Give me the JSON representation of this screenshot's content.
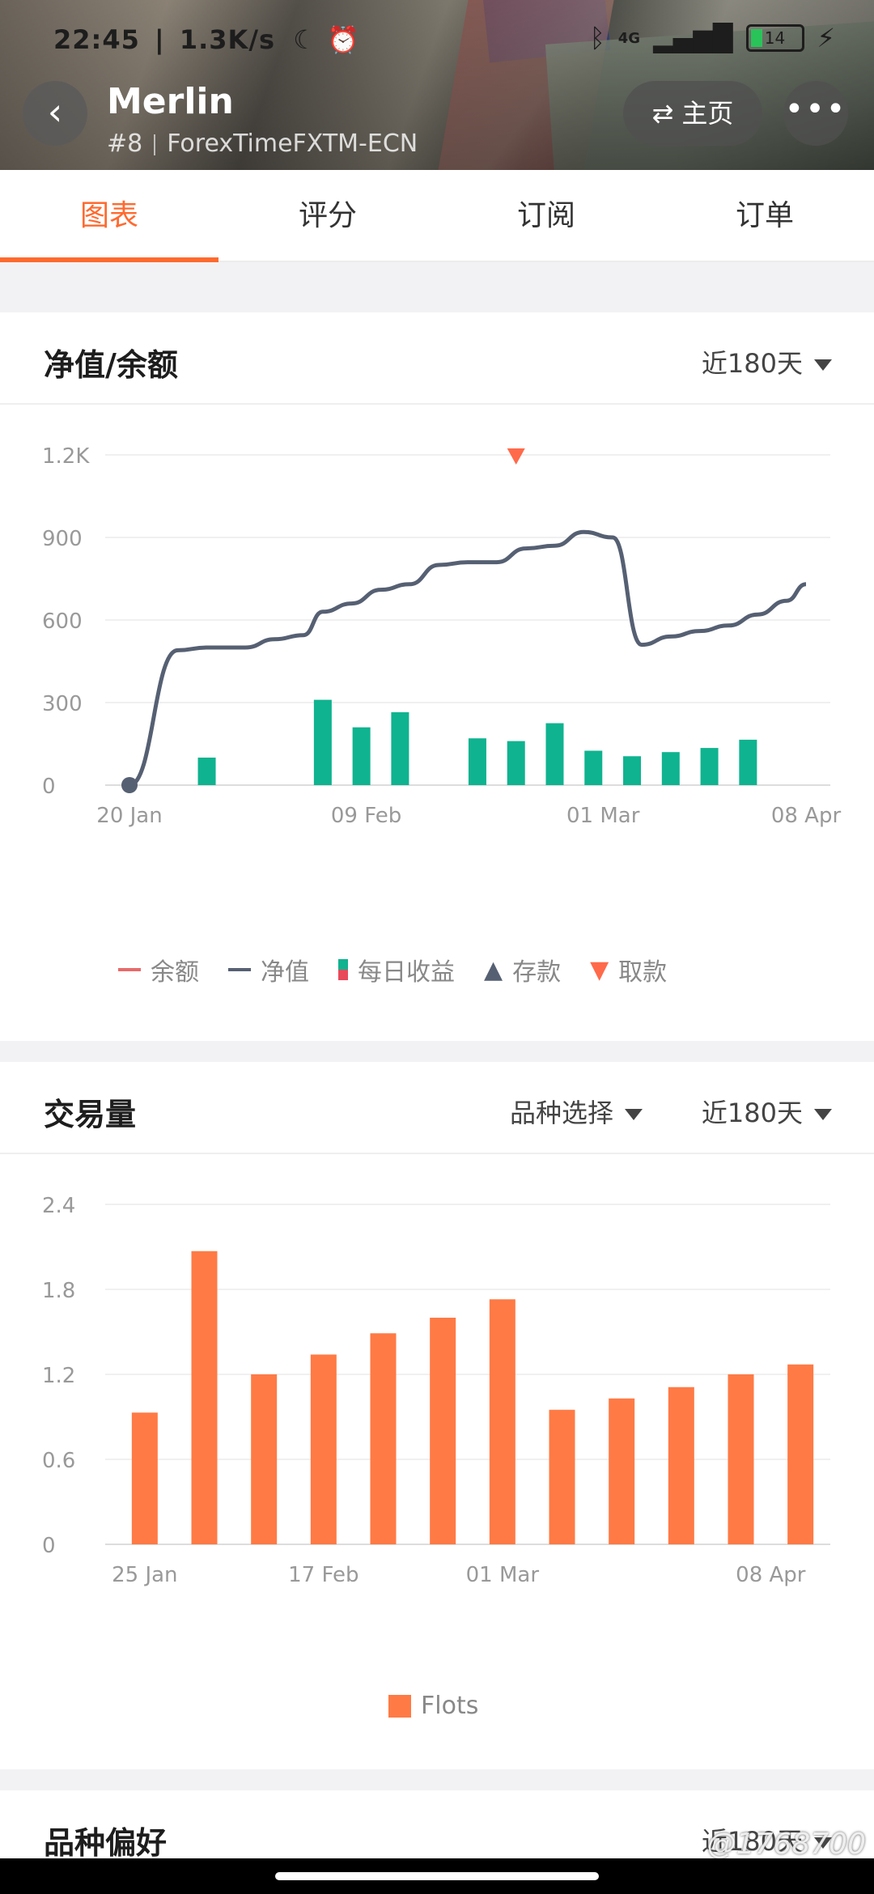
{
  "status_bar": {
    "time": "22:45",
    "net_speed": "1.3K/s",
    "network": "4G",
    "battery": "14"
  },
  "header": {
    "title": "Merlin",
    "rank": "#8",
    "broker": "ForexTimeFXTM-ECN",
    "home_label": "主页",
    "more_label": "•••"
  },
  "tabs": [
    {
      "label": "图表",
      "active": true
    },
    {
      "label": "评分",
      "active": false
    },
    {
      "label": "订阅",
      "active": false
    },
    {
      "label": "订单",
      "active": false
    }
  ],
  "equity_card": {
    "title": "净值/余额",
    "period": "近180天",
    "legend": [
      "余额",
      "净值",
      "每日收益",
      "存款",
      "取款"
    ],
    "colors": {
      "balance": "#e86a6a",
      "equity": "#566073",
      "profit": "#0fb38f",
      "deposit": "#566073",
      "withdraw": "#ff6a4a"
    }
  },
  "volume_card": {
    "title": "交易量",
    "symbol_filter": "品种选择",
    "period": "近180天",
    "legend": [
      "Flots"
    ],
    "color": "#ff7a45"
  },
  "pref_card": {
    "title": "品种偏好",
    "period": "近180天"
  },
  "watermark": "@1768700",
  "chart_data": [
    {
      "type": "line",
      "title": "",
      "y_ticks": [
        "0",
        "300",
        "600",
        "900",
        "1.2K"
      ],
      "ylim": [
        0,
        1200
      ],
      "x_ticks": [
        "20 Jan",
        "09 Feb",
        "01 Mar",
        "08 Apr"
      ],
      "series": [
        {
          "name": "净值",
          "x_days": [
            0,
            5,
            8,
            12,
            15,
            18,
            20,
            23,
            26,
            29,
            32,
            35,
            38,
            41,
            44,
            47,
            50,
            53,
            56,
            59,
            62,
            65,
            68,
            70
          ],
          "values": [
            0,
            490,
            500,
            500,
            530,
            545,
            630,
            660,
            710,
            730,
            800,
            810,
            810,
            860,
            870,
            920,
            900,
            510,
            540,
            560,
            580,
            620,
            670,
            730
          ]
        }
      ],
      "bars": {
        "name": "每日收益",
        "x_days": [
          8,
          16,
          20,
          24,
          28,
          36,
          40,
          44,
          48,
          52,
          56,
          60,
          64,
          68
        ],
        "values": [
          100,
          0,
          310,
          210,
          265,
          170,
          160,
          225,
          125,
          105,
          120,
          135,
          165,
          0
        ]
      },
      "markers": {
        "deposit": {
          "x_day": 0,
          "value": 0
        },
        "withdraw": {
          "x_day": 40,
          "value": 1200
        }
      },
      "grid": true,
      "legend_position": "bottom"
    },
    {
      "type": "bar",
      "title": "",
      "y_ticks": [
        "0",
        "0.6",
        "1.2",
        "1.8",
        "2.4"
      ],
      "ylim": [
        0,
        2.4
      ],
      "x_ticks": [
        "25 Jan",
        "17 Feb",
        "01 Mar",
        "08 Apr"
      ],
      "series": [
        {
          "name": "Flots",
          "values": [
            0.93,
            2.07,
            1.2,
            1.34,
            1.49,
            1.6,
            1.73,
            0.95,
            1.03,
            1.11,
            1.2,
            1.27
          ]
        }
      ],
      "grid": true,
      "legend_position": "bottom"
    }
  ]
}
